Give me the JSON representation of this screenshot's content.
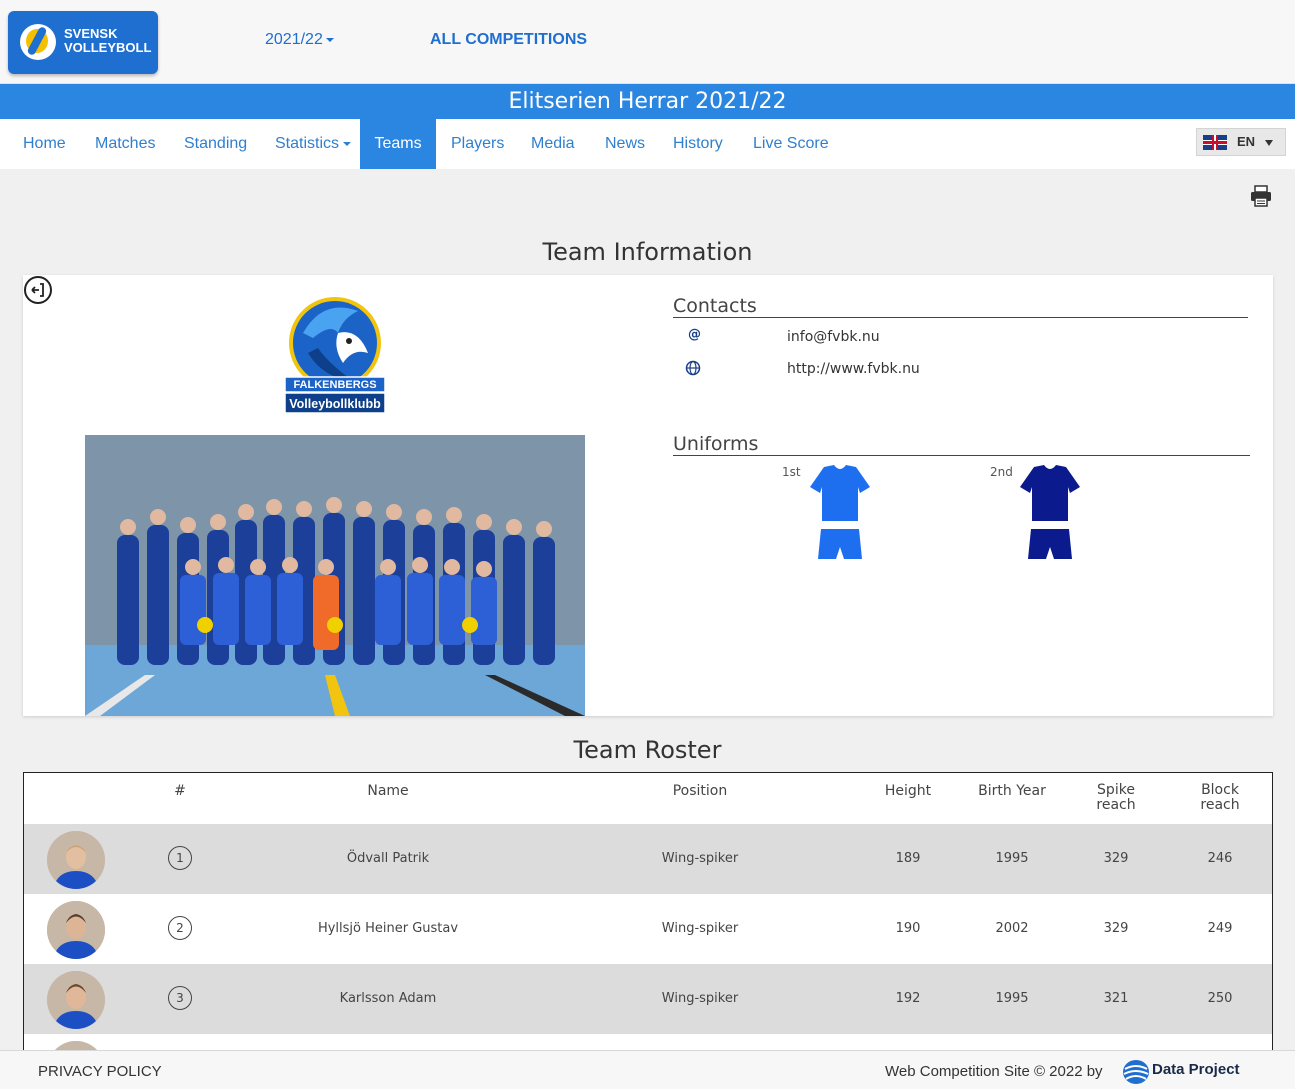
{
  "header": {
    "logo_text_line1": "SVENSK",
    "logo_text_line2": "VOLLEYBOLL",
    "season": "2021/22",
    "all_competitions": "ALL COMPETITIONS"
  },
  "competition_title": "Elitserien Herrar 2021/22",
  "nav": {
    "items": [
      {
        "label": "Home"
      },
      {
        "label": "Matches"
      },
      {
        "label": "Standing"
      },
      {
        "label": "Statistics"
      },
      {
        "label": "Teams"
      },
      {
        "label": "Players"
      },
      {
        "label": "Media"
      },
      {
        "label": "News"
      },
      {
        "label": "History"
      },
      {
        "label": "Live Score"
      }
    ],
    "active": "Teams",
    "language": "EN"
  },
  "team_info": {
    "title": "Team Information",
    "club_logo_line1": "FALKENBERGS",
    "club_logo_line2": "Volleybollklubb",
    "contacts_title": "Contacts",
    "email": "info@fvbk.nu",
    "website": "http://www.fvbk.nu",
    "uniforms_title": "Uniforms",
    "uniform_1_label": "1st",
    "uniform_2_label": "2nd",
    "uniform_1_color": "#1e6ff0",
    "uniform_2_color": "#0b1a8c"
  },
  "roster": {
    "title": "Team Roster",
    "headers": {
      "number": "#",
      "name": "Name",
      "position": "Position",
      "height": "Height",
      "birth_year": "Birth Year",
      "spike_reach_1": "Spike",
      "spike_reach_2": "reach",
      "block_reach_1": "Block",
      "block_reach_2": "reach"
    },
    "rows": [
      {
        "number": "1",
        "name": "Ödvall Patrik",
        "position": "Wing-spiker",
        "height": "189",
        "birth_year": "1995",
        "spike": "329",
        "block": "246"
      },
      {
        "number": "2",
        "name": "Hyllsjö Heiner Gustav",
        "position": "Wing-spiker",
        "height": "190",
        "birth_year": "2002",
        "spike": "329",
        "block": "249"
      },
      {
        "number": "3",
        "name": "Karlsson Adam",
        "position": "Wing-spiker",
        "height": "192",
        "birth_year": "1995",
        "spike": "321",
        "block": "250"
      }
    ]
  },
  "footer": {
    "privacy": "PRIVACY POLICY",
    "copyright": "Web Competition Site © 2022 by",
    "brand": "Data Project"
  }
}
